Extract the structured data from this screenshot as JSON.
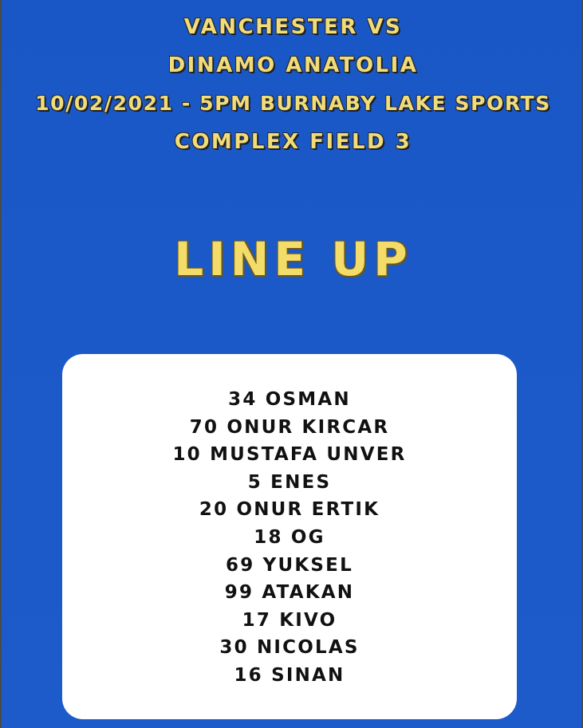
{
  "header": {
    "lines": [
      "VANCHESTER VS",
      "DINAMO ANATOLIA",
      "10/02/2021 - 5PM BURNABY LAKE SPORTS",
      "COMPLEX FIELD 3"
    ]
  },
  "title": "LINE UP",
  "lineup": [
    "34 OSMAN",
    "70 ONUR KIRCAR",
    "10 MUSTAFA UNVER",
    "5 ENES",
    "20 ONUR ERTIK",
    "18 OG",
    "69 YUKSEL",
    "99 ATAKAN",
    "17 KIVO",
    "30 NICOLAS",
    "16 SINAN"
  ],
  "colors": {
    "background": "#1b59c8",
    "title_yellow": "#f4dc6a",
    "card": "#ffffff",
    "text_dark": "#111111"
  }
}
